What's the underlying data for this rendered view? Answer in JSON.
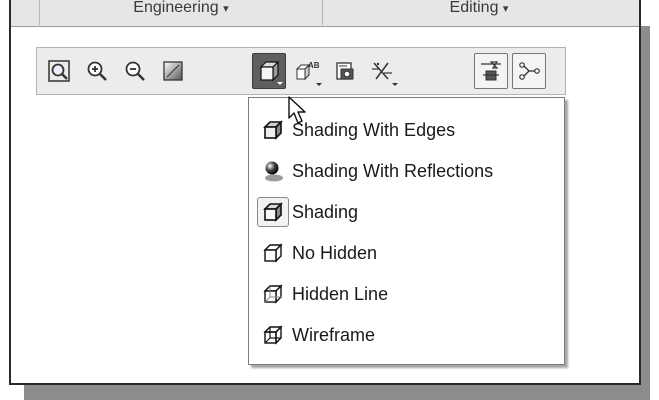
{
  "tabs": [
    {
      "label": "Engineering",
      "caret": "▾"
    },
    {
      "label": "Editing",
      "caret": "▾"
    }
  ],
  "toolbar": {
    "buttons": [
      {
        "icon": "zoom-fit-icon"
      },
      {
        "icon": "zoom-in-icon"
      },
      {
        "icon": "zoom-out-icon"
      },
      {
        "icon": "view-style-icon"
      },
      {
        "icon": "shading-cube-icon",
        "state": "pressed",
        "has_dropdown": true
      },
      {
        "icon": "annotation-display-icon",
        "has_dropdown": true
      },
      {
        "icon": "saved-views-icon"
      },
      {
        "icon": "datum-display-icon",
        "has_dropdown": true
      },
      {
        "icon": "plane-display-icon",
        "state": "selected"
      },
      {
        "icon": "axis-display-icon",
        "state": "selected"
      }
    ]
  },
  "display_menu": {
    "items": [
      {
        "label": "Shading With Edges",
        "icon": "shading-with-edges-icon"
      },
      {
        "label": "Shading With Reflections",
        "icon": "shading-with-reflections-icon"
      },
      {
        "label": "Shading",
        "icon": "shading-icon",
        "selected": true
      },
      {
        "label": "No Hidden",
        "icon": "no-hidden-icon"
      },
      {
        "label": "Hidden Line",
        "icon": "hidden-line-icon"
      },
      {
        "label": "Wireframe",
        "icon": "wireframe-icon"
      }
    ]
  }
}
